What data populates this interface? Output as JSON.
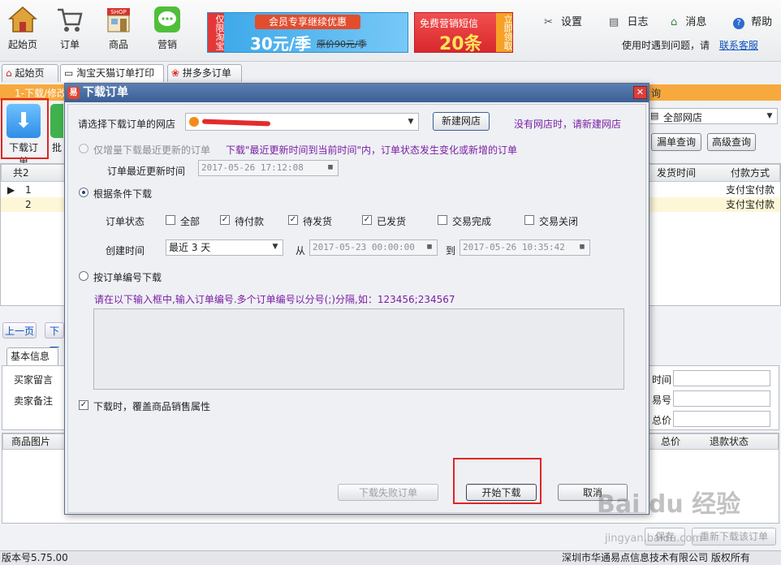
{
  "toolbar": {
    "items": [
      {
        "label": "起始页",
        "icon": "home-icon"
      },
      {
        "label": "订单",
        "icon": "cart-icon"
      },
      {
        "label": "商品",
        "icon": "shop-icon"
      },
      {
        "label": "营销",
        "icon": "wechat-chat-icon"
      }
    ],
    "banner1": {
      "tag": "仅限淘宝",
      "line1": "会员专享继续优惠",
      "price": "30元/季",
      "original": "原价90元/季"
    },
    "banner2": {
      "line1": "免费营销短信",
      "count": "20条",
      "cta": "立即领取"
    },
    "settings_label": "设置",
    "log_label": "日志",
    "message_label": "消息",
    "help_label": "帮助",
    "problem_text": "使用时遇到问题，请",
    "contact_link": "联系客服"
  },
  "tabs": [
    {
      "label": "起始页"
    },
    {
      "label": "淘宝天猫订单打印"
    },
    {
      "label": "拼多多订单"
    }
  ],
  "background": {
    "orange_left": "1-下载/修改",
    "orange_right": "询",
    "left_buttons": {
      "download": "下载订单",
      "batch": "批"
    },
    "shop_select": "全部网店",
    "missed_query": "漏单查询",
    "advanced_query": "高级查询",
    "grid": {
      "count_label": "共2",
      "col_ship_time": "发货时间",
      "col_payment": "付款方式",
      "rows": [
        {
          "no": "1",
          "payment": "支付宝付款"
        },
        {
          "no": "2",
          "payment": "支付宝付款"
        }
      ]
    },
    "pager": {
      "prev": "上一页",
      "next": "下一"
    },
    "detail_tabs": {
      "basic": "基本信息"
    },
    "buyer_msg": "买家留言",
    "seller_note": "卖家备注",
    "right_labels": {
      "time": "时间",
      "number": "易号",
      "total": "总价"
    },
    "product_grid": {
      "image": "商品图片",
      "total": "总价",
      "refund": "退款状态"
    },
    "bottom_buttons": {
      "save": "保存",
      "redownload": "重新下载该订单"
    }
  },
  "dialog": {
    "title": "下载订单",
    "shop_label": "请选择下载订单的网店",
    "new_shop_button": "新建网店",
    "no_shop_hint": "没有网店时，请新建网店",
    "incremental_option": "仅增量下载最近更新的订单",
    "incremental_hint": "下载\"最近更新时间到当前时间\"内，订单状态发生变化或新增的订单",
    "last_update_label": "订单最近更新时间",
    "last_update_value": "2017-05-26 17:12:08",
    "by_condition_option": "根据条件下载",
    "status_label": "订单状态",
    "statuses": [
      {
        "label": "全部",
        "checked": false
      },
      {
        "label": "待付款",
        "checked": true
      },
      {
        "label": "待发货",
        "checked": true
      },
      {
        "label": "已发货",
        "checked": true
      },
      {
        "label": "交易完成",
        "checked": false
      },
      {
        "label": "交易关闭",
        "checked": false
      }
    ],
    "created_label": "创建时间",
    "created_range": "最近 3 天",
    "from_label": "从",
    "from_value": "2017-05-23 00:00:00",
    "to_label": "到",
    "to_value": "2017-05-26 10:35:42",
    "by_number_option": "按订单编号下载",
    "by_number_hint": "请在以下输入框中,输入订单编号.多个订单编号以分号(;)分隔,如：123456;234567",
    "cover_option": "下载时，覆盖商品销售属性",
    "failed_button": "下载失败订单",
    "start_button": "开始下载",
    "cancel_button": "取消"
  },
  "status_bar": {
    "version": "版本号5.75.00",
    "company": "深圳市华通易点信息技术有限公司 版权所有"
  },
  "watermark": {
    "brand": "Bai du 经验",
    "url": "jingyan.baidu.com"
  }
}
